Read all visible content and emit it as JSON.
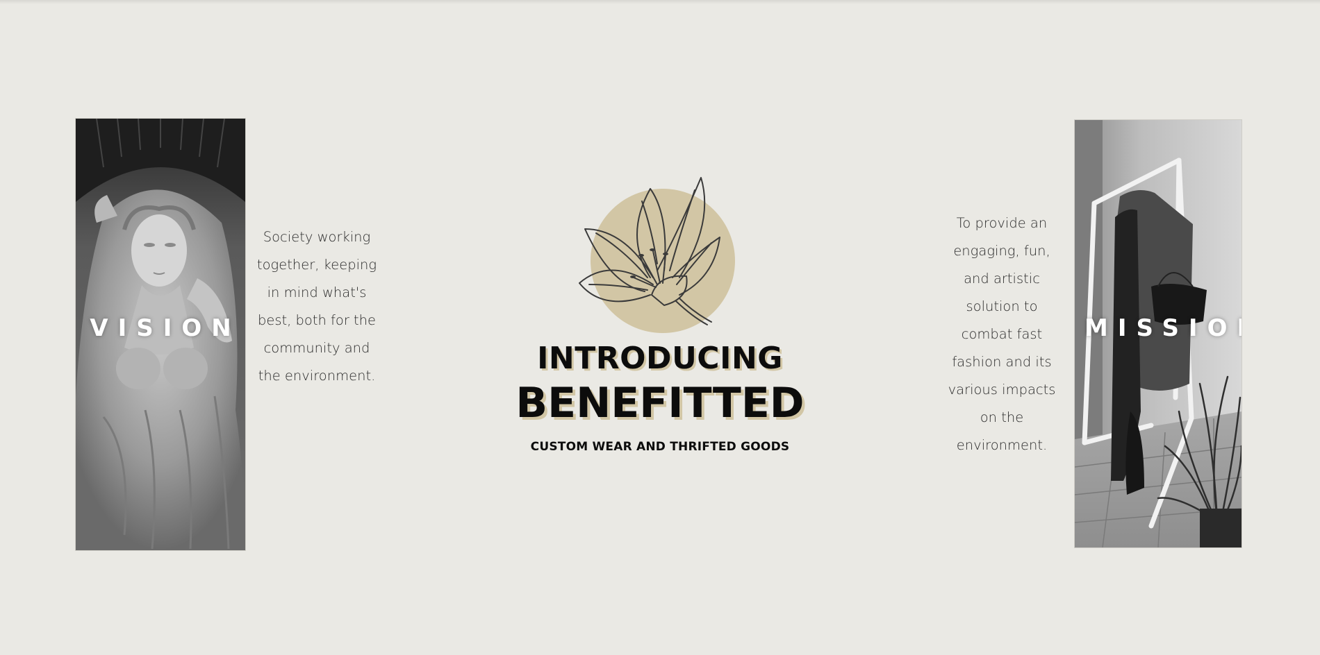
{
  "vision": {
    "label": "VISION",
    "text": "Society working together, keeping in mind what's best, both for the community and the environment."
  },
  "mission": {
    "label": "MISSION",
    "text": "To provide an engaging, fun, and artistic solution to combat fast fashion and its various impacts on the environment."
  },
  "hero": {
    "intro": "INTRODUCING",
    "brand": "BENEFITTED",
    "tagline": "CUSTOM WEAR AND THRIFTED GOODS"
  },
  "colors": {
    "background": "#eae9e4",
    "accent_circle": "#d2c6a5",
    "text_dark": "#0c0c0c",
    "label_white": "#ffffff"
  },
  "icons": {
    "flower": "lily-flower-icon"
  }
}
